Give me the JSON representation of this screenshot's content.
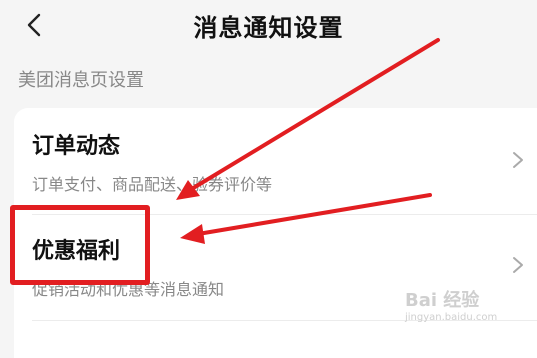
{
  "header": {
    "title": "消息通知设置",
    "back_icon": "chevron-left-icon"
  },
  "section": {
    "label": "美团消息页设置"
  },
  "settings": [
    {
      "title": "订单动态",
      "description": "订单支付、商品配送、验券评价等",
      "chevron_icon": "chevron-right-icon"
    },
    {
      "title": "优惠福利",
      "description": "促销活动和优惠等消息通知",
      "chevron_icon": "chevron-right-icon"
    }
  ],
  "annotation": {
    "highlight_color": "#e21e21",
    "arrow_color": "#e21e21"
  },
  "watermark": {
    "brand": "Bai 经验",
    "site": "jingyan.baidu.com"
  }
}
